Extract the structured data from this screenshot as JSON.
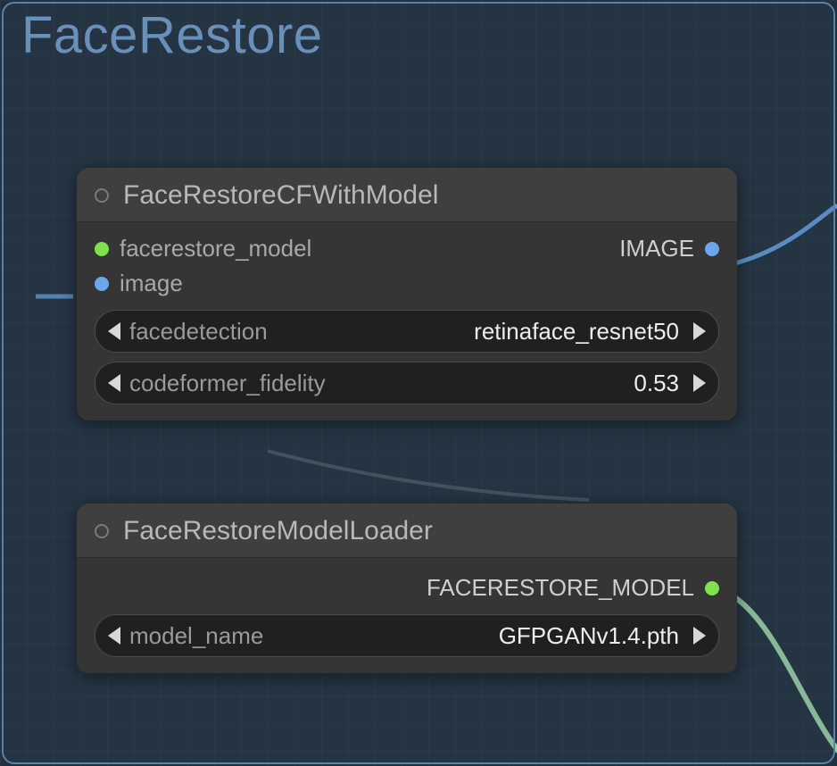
{
  "group": {
    "title": "FaceRestore"
  },
  "nodes": {
    "cf": {
      "title": "FaceRestoreCFWithModel",
      "inputs": {
        "facerestore_model": "facerestore_model",
        "image": "image"
      },
      "outputs": {
        "image": "IMAGE"
      },
      "widgets": {
        "facedetection": {
          "label": "facedetection",
          "value": "retinaface_resnet50"
        },
        "codeformer_fidelity": {
          "label": "codeformer_fidelity",
          "value": "0.53"
        }
      }
    },
    "loader": {
      "title": "FaceRestoreModelLoader",
      "outputs": {
        "facerestore_model": "FACERESTORE_MODEL"
      },
      "widgets": {
        "model_name": {
          "label": "model_name",
          "value": "GFPGANv1.4.pth"
        }
      }
    }
  }
}
